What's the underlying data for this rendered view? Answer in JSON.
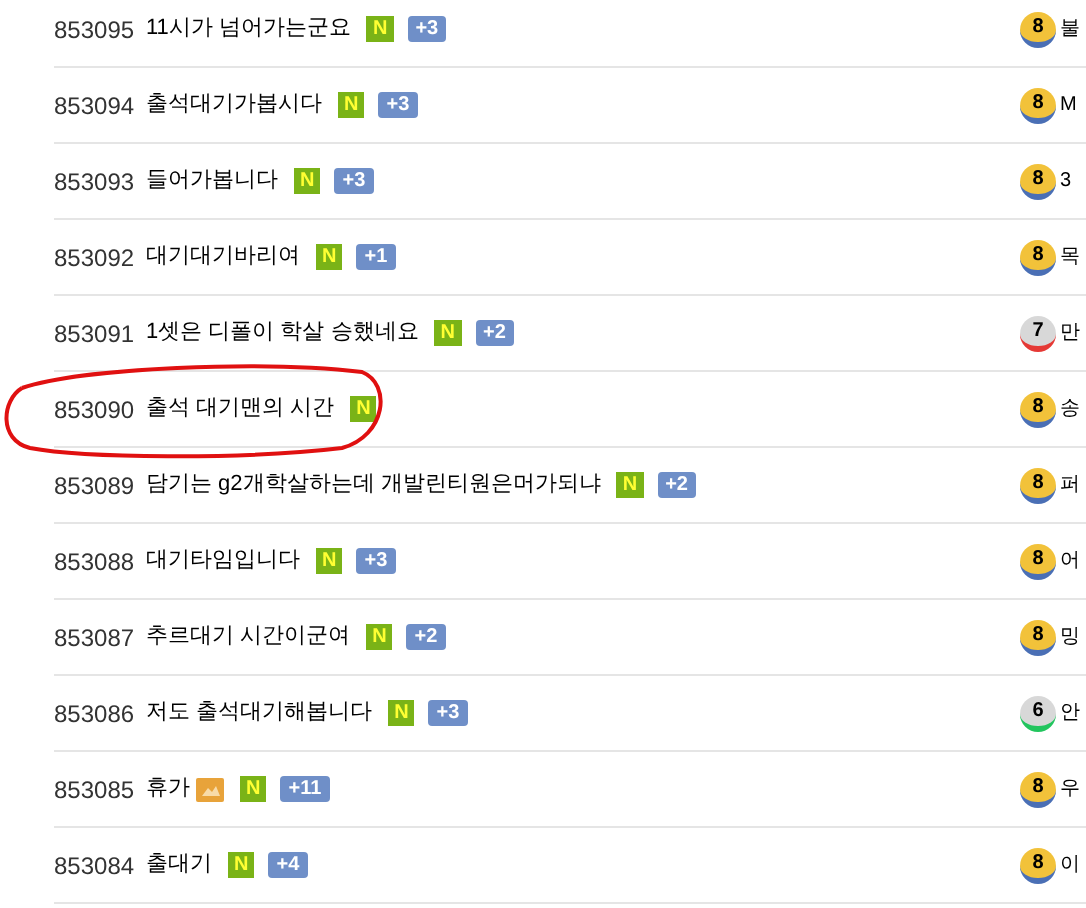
{
  "rows": [
    {
      "number": "853095",
      "title": "11시가 넘어가는군요",
      "has_image": false,
      "new": "N",
      "comments": "+3",
      "highlighted": false,
      "level": {
        "text": "8",
        "kind": "gold"
      },
      "author": "불"
    },
    {
      "number": "853094",
      "title": "출석대기가봅시다",
      "has_image": false,
      "new": "N",
      "comments": "+3",
      "highlighted": false,
      "level": {
        "text": "8",
        "kind": "gold"
      },
      "author": "M"
    },
    {
      "number": "853093",
      "title": "들어가봅니다",
      "has_image": false,
      "new": "N",
      "comments": "+3",
      "highlighted": false,
      "level": {
        "text": "8",
        "kind": "gold"
      },
      "author": "3"
    },
    {
      "number": "853092",
      "title": "대기대기바리여",
      "has_image": false,
      "new": "N",
      "comments": "+1",
      "highlighted": false,
      "level": {
        "text": "8",
        "kind": "gold"
      },
      "author": "목"
    },
    {
      "number": "853091",
      "title": "1셋은 디폴이 학살 승했네요",
      "has_image": false,
      "new": "N",
      "comments": "+2",
      "highlighted": false,
      "level": {
        "text": "7",
        "kind": "silver",
        "color": "#e53935"
      },
      "author": "만"
    },
    {
      "number": "853090",
      "title": "출석 대기맨의 시간",
      "has_image": false,
      "new": "N",
      "highlighted": true,
      "level": {
        "text": "8",
        "kind": "gold"
      },
      "author": "송"
    },
    {
      "number": "853089",
      "title": "담기는 g2개학살하는데 개발린티원은머가되냐",
      "has_image": false,
      "new": "N",
      "comments": "+2",
      "highlighted": false,
      "level": {
        "text": "8",
        "kind": "gold"
      },
      "author": "퍼"
    },
    {
      "number": "853088",
      "title": "대기타임입니다",
      "has_image": false,
      "new": "N",
      "comments": "+3",
      "highlighted": false,
      "level": {
        "text": "8",
        "kind": "gold"
      },
      "author": "어"
    },
    {
      "number": "853087",
      "title": "추르대기 시간이군여",
      "has_image": false,
      "new": "N",
      "comments": "+2",
      "highlighted": false,
      "level": {
        "text": "8",
        "kind": "gold"
      },
      "author": "밍"
    },
    {
      "number": "853086",
      "title": "저도 출석대기해봅니다",
      "has_image": false,
      "new": "N",
      "comments": "+3",
      "highlighted": false,
      "level": {
        "text": "6",
        "kind": "silver",
        "color": "#22c55e"
      },
      "author": "안"
    },
    {
      "number": "853085",
      "title": "휴가",
      "has_image": true,
      "new": "N",
      "comments": "+11",
      "highlighted": false,
      "level": {
        "text": "8",
        "kind": "gold"
      },
      "author": "우"
    },
    {
      "number": "853084",
      "title": "출대기",
      "has_image": false,
      "new": "N",
      "comments": "+4",
      "highlighted": false,
      "level": {
        "text": "8",
        "kind": "gold"
      },
      "author": "이"
    }
  ]
}
